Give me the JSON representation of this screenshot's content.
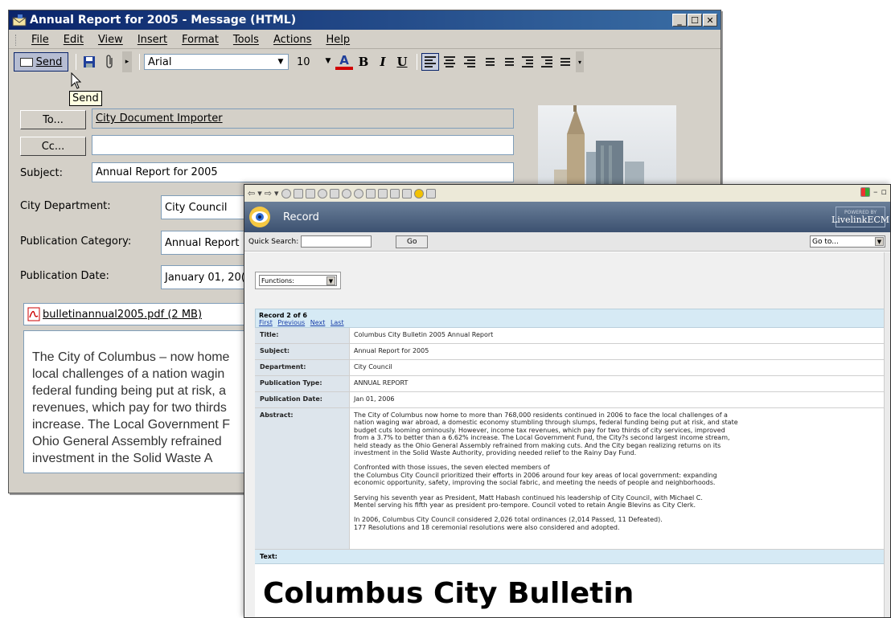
{
  "outlook": {
    "title": "Annual Report for 2005 - Message (HTML)",
    "menu": [
      "File",
      "Edit",
      "View",
      "Insert",
      "Format",
      "Tools",
      "Actions",
      "Help"
    ],
    "toolbar": {
      "send_label": "Send",
      "font": "Arial",
      "size": "10",
      "bold": "B",
      "italic": "I",
      "underline": "U",
      "font_color_glyph": "A"
    },
    "tooltip": "Send",
    "to_button": "To...",
    "cc_button": "Cc...",
    "to_value": "City Document Importer",
    "cc_value": "",
    "subject_label": "Subject:",
    "subject_value": "Annual Report for 2005",
    "fields": [
      {
        "label": "City Department:",
        "value": "City Council"
      },
      {
        "label": "Publication Category:",
        "value": "Annual Report"
      },
      {
        "label": "Publication Date:",
        "value": "January 01, 20("
      }
    ],
    "attachment": "bulletinannual2005.pdf (2 MB)",
    "body_lines": [
      "The City of Columbus – now home",
      "local challenges of a nation wagin",
      "federal funding being put at risk, a",
      "revenues, which pay for two thirds",
      "increase. The Local Government F",
      "Ohio General Assembly refrained",
      "investment in the Solid Waste A"
    ]
  },
  "browser": {
    "header_title": "Record",
    "logo_powered": "POWERED BY",
    "logo_text": "LivelinkECM",
    "quick_search_label": "Quick Search:",
    "go_label": "Go",
    "goto_label": "Go to...",
    "functions_label": "Functions:",
    "record_count": "Record 2 of 6",
    "nav_links": [
      "First",
      "Previous",
      "Next",
      "Last"
    ],
    "rows": [
      {
        "label": "Title:",
        "value": "Columbus City Bulletin 2005 Annual Report"
      },
      {
        "label": "Subject:",
        "value": "Annual Report for 2005"
      },
      {
        "label": "Department:",
        "value": "City Council"
      },
      {
        "label": "Publication Type:",
        "value": "ANNUAL REPORT"
      },
      {
        "label": "Publication Date:",
        "value": "Jan 01, 2006"
      }
    ],
    "abstract_label": "Abstract:",
    "abstract_paragraphs": [
      "The City of Columbus  now home to more than 768,000 residents continued in 2006 to face the local challenges of a\nnation waging war abroad, a domestic economy stumbling through slumps, federal funding being put at risk, and state\nbudget cuts looming ominously. However, income tax revenues, which pay for two thirds of city services, improved\nfrom a 3.7% to better than a 6.62% increase. The Local Government Fund, the City?s second largest income stream,\nheld steady as the Ohio General Assembly refrained from making cuts. And the City began realizing returns on its\ninvestment in the Solid Waste Authority, providing needed relief to the Rainy Day Fund.",
      "Confronted with those issues, the seven elected members of\nthe Columbus City Council prioritized their efforts in 2006 around four key areas of local government: expanding\neconomic opportunity, safety, improving the social fabric, and meeting the needs of people and neighborhoods.",
      "Serving his seventh year as President, Matt Habash continued his leadership of City Council, with Michael C.\nMentel serving his fifth year as president pro-tempore. Council voted to retain Angie Blevins as City Clerk.",
      "In 2006, Columbus City Council considered 2,026 total ordinances (2,014 Passed, 11 Defeated).\n177 Resolutions and 18 ceremonial resolutions were also considered and adopted."
    ],
    "text_label": "Text:",
    "bulletin_title": "Columbus City Bulletin"
  },
  "colors": {
    "titlebar": "#0a246a",
    "header": "#4a5f7e",
    "nav_bg": "#d6eaf5"
  }
}
